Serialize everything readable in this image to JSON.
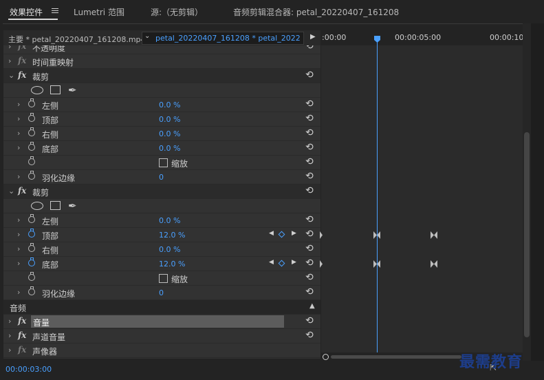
{
  "tabs": [
    {
      "label": "效果控件",
      "active": true
    },
    {
      "label": "Lumetri 范围",
      "active": false
    },
    {
      "label": "源:（无剪辑）",
      "active": false
    },
    {
      "label": "音频剪辑混合器: petal_20220407_161208",
      "active": false
    }
  ],
  "header": {
    "master_clip": "主要 * petal_20220407_161208.mp4",
    "sequence_clip": "petal_20220407_161208 * petal_202204..."
  },
  "timeline": {
    "ruler_labels": [
      ":00:00",
      "00:00:05:00",
      "00:00:10"
    ]
  },
  "rows": {
    "opacity": "不透明度",
    "time_remap": "时间重映射",
    "crop1": {
      "title": "裁剪",
      "left": {
        "label": "左侧",
        "value": "0.0 %"
      },
      "top": {
        "label": "顶部",
        "value": "0.0 %"
      },
      "right": {
        "label": "右侧",
        "value": "0.0 %"
      },
      "bottom": {
        "label": "底部",
        "value": "0.0 %"
      },
      "zoom": {
        "label": "缩放"
      },
      "feather": {
        "label": "羽化边缘",
        "value": "0"
      }
    },
    "crop2": {
      "title": "裁剪",
      "left": {
        "label": "左侧",
        "value": "0.0 %"
      },
      "top": {
        "label": "顶部",
        "value": "12.0 %"
      },
      "right": {
        "label": "右侧",
        "value": "0.0 %"
      },
      "bottom": {
        "label": "底部",
        "value": "12.0 %"
      },
      "zoom": {
        "label": "缩放"
      },
      "feather": {
        "label": "羽化边缘",
        "value": "0"
      }
    }
  },
  "audio": {
    "section": "音频",
    "volume": "音量",
    "channel_volume": "声道音量",
    "panner": "声像器"
  },
  "footer": {
    "timecode": "00:00:03:00"
  },
  "watermark": "最需教育",
  "colors": {
    "accent": "#4aa0ff",
    "panel": "#323232"
  }
}
